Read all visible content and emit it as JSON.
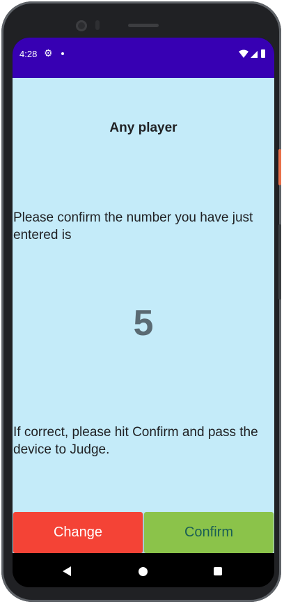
{
  "status_bar": {
    "time": "4:28",
    "icons": [
      "settings-gear-icon",
      "notification-dot-icon",
      "wifi-icon",
      "signal-icon",
      "battery-icon"
    ],
    "background_color": "#3700b3"
  },
  "screen": {
    "title": "Any player",
    "prompt": "Please confirm the number you have just entered is",
    "entered_number": "5",
    "instruction": "If correct, please hit Confirm and pass the device to Judge.",
    "background_color": "#c4ebf9"
  },
  "actions": {
    "change_label": "Change",
    "change_color": "#f44336",
    "confirm_label": "Confirm",
    "confirm_color": "#8bc34a"
  },
  "nav_bar": {
    "buttons": [
      "back-icon",
      "home-icon",
      "recents-icon"
    ]
  }
}
